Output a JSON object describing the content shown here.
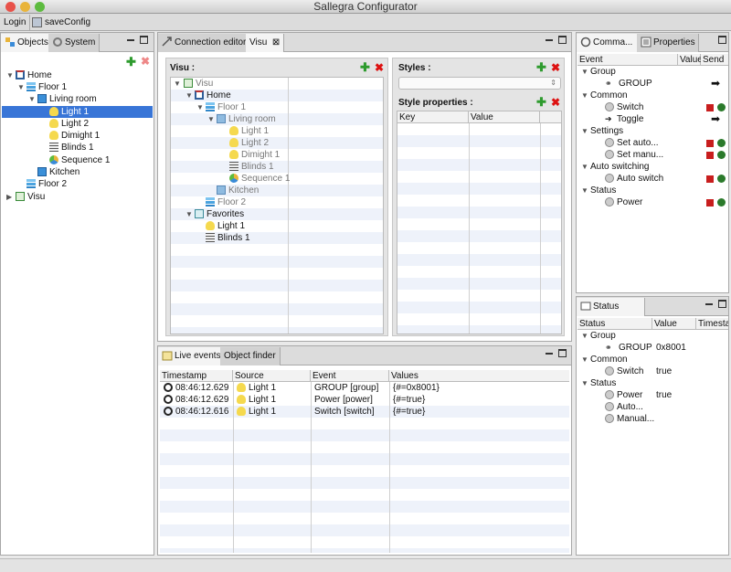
{
  "window": {
    "title": "Sallegra Configurator"
  },
  "toolbar": {
    "login": "Login",
    "save": "saveConfig"
  },
  "objects_panel": {
    "tabs": [
      "Objects",
      "System"
    ],
    "tree": [
      {
        "label": "Home",
        "icon": "home-icon"
      },
      {
        "label": "Floor 1",
        "icon": "floor-icon"
      },
      {
        "label": "Living room",
        "icon": "room-icon"
      },
      {
        "label": "Light 1",
        "icon": "bulb-icon",
        "selected": true
      },
      {
        "label": "Light 2",
        "icon": "bulb-icon"
      },
      {
        "label": "Dimight 1",
        "icon": "bulb-icon"
      },
      {
        "label": "Blinds 1",
        "icon": "blinds-icon"
      },
      {
        "label": "Sequence 1",
        "icon": "sequence-icon"
      },
      {
        "label": "Kitchen",
        "icon": "room-icon"
      },
      {
        "label": "Floor 2",
        "icon": "floor-icon"
      },
      {
        "label": "Visu",
        "icon": "visu-icon"
      }
    ]
  },
  "editor": {
    "tabs": [
      "Connection editor",
      "Visu"
    ],
    "visu_label": "Visu :",
    "visu_tree": [
      {
        "label": "Visu",
        "icon": "visu-icon",
        "grey": true
      },
      {
        "label": "Home",
        "icon": "home-icon"
      },
      {
        "label": "Floor 1",
        "icon": "floor-icon",
        "grey": true
      },
      {
        "label": "Living room",
        "icon": "room-icon",
        "grey": true
      },
      {
        "label": "Light 1",
        "icon": "bulb-icon",
        "grey": true
      },
      {
        "label": "Light 2",
        "icon": "bulb-icon",
        "grey": true
      },
      {
        "label": "Dimight 1",
        "icon": "bulb-icon",
        "grey": true
      },
      {
        "label": "Blinds 1",
        "icon": "blinds-icon",
        "grey": true
      },
      {
        "label": "Sequence 1",
        "icon": "sequence-icon",
        "grey": true
      },
      {
        "label": "Kitchen",
        "icon": "room-icon",
        "grey": true
      },
      {
        "label": "Floor 2",
        "icon": "floor-icon",
        "grey": true
      },
      {
        "label": "Favorites",
        "icon": "favorites-icon"
      },
      {
        "label": "Light 1",
        "icon": "bulb-icon"
      },
      {
        "label": "Blinds 1",
        "icon": "blinds-icon"
      }
    ],
    "styles_label": "Styles :",
    "style_props_label": "Style properties :",
    "style_columns": [
      "Key",
      "Value"
    ]
  },
  "events_panel": {
    "tabs": [
      "Live events",
      "Object finder"
    ],
    "columns": [
      "Timestamp",
      "Source",
      "Event",
      "Values"
    ],
    "rows": [
      {
        "time": "08:46:12.629",
        "source": "Light 1",
        "event": "GROUP [group]",
        "values": "{#=0x8001}"
      },
      {
        "time": "08:46:12.629",
        "source": "Light 1",
        "event": "Power [power]",
        "values": "{#=true}"
      },
      {
        "time": "08:46:12.616",
        "source": "Light 1",
        "event": "Switch [switch]",
        "values": "{#=true}"
      }
    ]
  },
  "commands_panel": {
    "tabs": [
      "Comma...",
      "Properties"
    ],
    "columns": [
      "Event",
      "Value",
      "Send"
    ],
    "groups": [
      {
        "name": "Group",
        "items": [
          {
            "label": "GROUP",
            "send": "arrow"
          }
        ]
      },
      {
        "name": "Common",
        "items": [
          {
            "label": "Switch",
            "send": "buttons"
          },
          {
            "label": "Toggle",
            "send": "arrow"
          }
        ]
      },
      {
        "name": "Settings",
        "items": [
          {
            "label": "Set auto...",
            "send": "buttons"
          },
          {
            "label": "Set manu...",
            "send": "buttons"
          }
        ]
      },
      {
        "name": "Auto switching",
        "items": [
          {
            "label": "Auto switch",
            "send": "buttons"
          }
        ]
      },
      {
        "name": "Status",
        "items": [
          {
            "label": "Power",
            "send": "buttons"
          }
        ]
      }
    ]
  },
  "status_panel": {
    "tabs": [
      "Status"
    ],
    "columns": [
      "Status",
      "Value",
      "Timesta"
    ],
    "groups": [
      {
        "name": "Group",
        "items": [
          {
            "label": "GROUP",
            "value": "0x8001"
          }
        ]
      },
      {
        "name": "Common",
        "items": [
          {
            "label": "Switch",
            "value": "true"
          }
        ]
      },
      {
        "name": "Status",
        "items": [
          {
            "label": "Power",
            "value": "true"
          },
          {
            "label": "Auto...",
            "value": ""
          },
          {
            "label": "Manual...",
            "value": ""
          }
        ]
      }
    ]
  },
  "colors": {
    "selection": "#3875d7",
    "stripe": "#eef2fa",
    "red": "#c81e1e",
    "green": "#2b7a2b"
  }
}
